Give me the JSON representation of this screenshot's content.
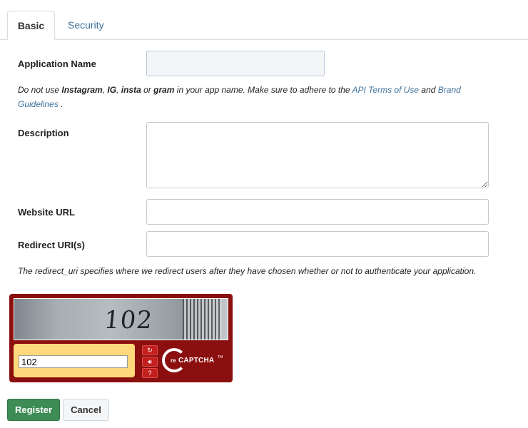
{
  "tabs": [
    {
      "label": "Basic"
    },
    {
      "label": "Security"
    }
  ],
  "form": {
    "app_name_label": "Application Name",
    "app_name_value": "",
    "help": {
      "part1": "Do not use ",
      "kw1": "Instagram",
      "sep1": ", ",
      "kw2": "IG",
      "sep2": ", ",
      "kw3": "insta",
      "sep3": " or ",
      "kw4": "gram",
      "part2": " in your app name. Make sure to adhere to the ",
      "link1": "API Terms of Use",
      "part3": " and ",
      "link2": "Brand Guidelines",
      "part4": " ."
    },
    "description_label": "Description",
    "description_value": "",
    "website_label": "Website URL",
    "website_value": "",
    "redirect_label": "Redirect URI(s)",
    "redirect_value": "",
    "redirect_help": "The redirect_uri specifies where we redirect users after they have chosen whether or not to authenticate your application."
  },
  "captcha": {
    "image_text": "102",
    "input_value": "102",
    "logo_re": "re",
    "logo_text": "CAPTCHA",
    "logo_tm": "TM",
    "icons": [
      "refresh-icon",
      "audio-icon",
      "help-icon"
    ]
  },
  "buttons": {
    "register": "Register",
    "cancel": "Cancel"
  },
  "colors": {
    "link": "#3f729b",
    "register": "#3d8b55",
    "captcha_frame": "#8b0f0f",
    "captcha_input_bg": "#fdd97b"
  }
}
